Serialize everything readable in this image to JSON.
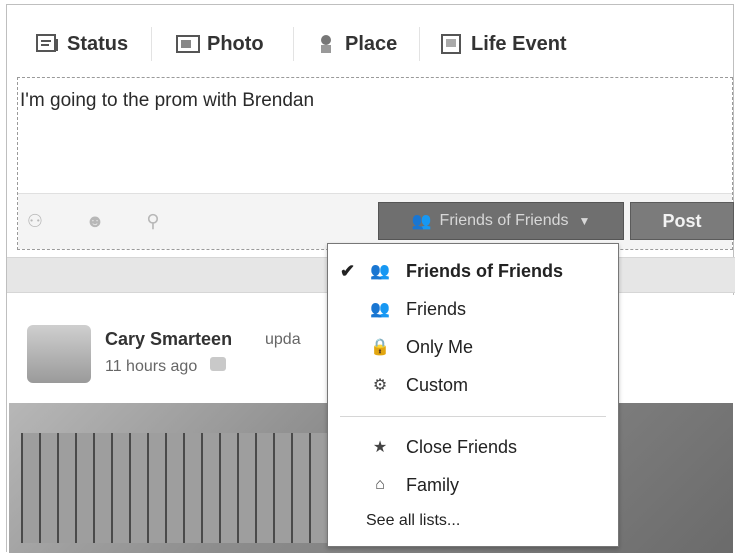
{
  "tabs": {
    "status": "Status",
    "photo": "Photo",
    "place": "Place",
    "life_event": "Life Event"
  },
  "composer": {
    "text": "I'm going to the prom with Brendan",
    "audience_label": "Friends of Friends",
    "post_label": "Post",
    "icons": [
      "add-people-icon",
      "emoji-icon",
      "location-icon"
    ]
  },
  "story": {
    "author": "Cary Smarteen",
    "action": "upda",
    "time": "11 hours ago"
  },
  "dropdown": {
    "items": [
      {
        "label": "Friends of Friends",
        "checked": true
      },
      {
        "label": "Friends",
        "checked": false
      },
      {
        "label": "Only Me",
        "checked": false
      },
      {
        "label": "Custom",
        "checked": false
      },
      {
        "label": "Close Friends",
        "checked": false
      },
      {
        "label": "Family",
        "checked": false
      }
    ],
    "see_all": "See all lists..."
  },
  "colors": {
    "audience_bg": "#6f6f6f",
    "post_bg": "#7b7b7b",
    "band": "#e6e6e6"
  }
}
